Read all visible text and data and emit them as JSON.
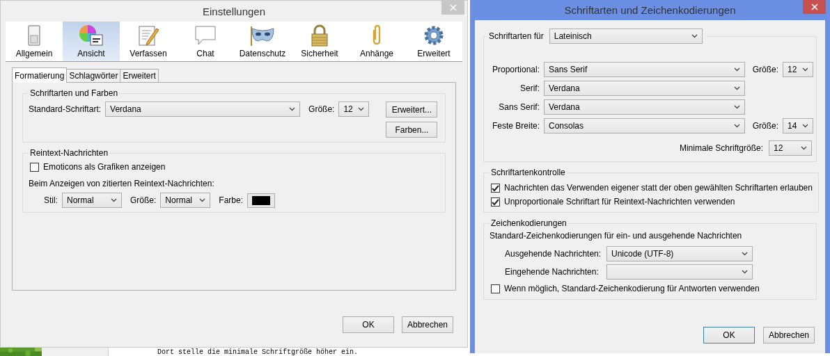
{
  "settings_window": {
    "title": "Einstellungen",
    "toolbar": [
      {
        "label": "Allgemein",
        "selected": false
      },
      {
        "label": "Ansicht",
        "selected": true
      },
      {
        "label": "Verfassen",
        "selected": false
      },
      {
        "label": "Chat",
        "selected": false
      },
      {
        "label": "Datenschutz",
        "selected": false
      },
      {
        "label": "Sicherheit",
        "selected": false
      },
      {
        "label": "Anhänge",
        "selected": false
      },
      {
        "label": "Erweitert",
        "selected": false
      }
    ],
    "tabs": [
      {
        "label": "Formatierung",
        "selected": true
      },
      {
        "label": "Schlagwörter",
        "selected": false
      },
      {
        "label": "Erweitert",
        "selected": false
      }
    ],
    "fonts_group": {
      "legend": "Schriftarten und Farben",
      "font_label": "Standard-Schriftart:",
      "font": "Verdana",
      "size_label": "Größe:",
      "size": "12",
      "buttons": [
        "Erweitert...",
        "Farben..."
      ]
    },
    "plaintext_group": {
      "legend": "Reintext-Nachrichten",
      "emoticons": {
        "label": "Emoticons als Grafiken anzeigen",
        "checked": false
      },
      "quoted_label": "Beim Anzeigen von zitierten Reintext-Nachrichten:",
      "style_label": "Stil:",
      "style": "Normal",
      "size_label": "Größe:",
      "size": "Normal",
      "color_label": "Farbe:",
      "color": "#000000"
    },
    "buttons": [
      "OK",
      "Abbrechen"
    ]
  },
  "background_text": "Dort stelle die minimale Schriftgröße höher ein.",
  "fonts_window": {
    "title": "Schriftarten und Zeichenkodierungen",
    "fonts_for_label": "Schriftarten für",
    "fonts_for": "Lateinisch",
    "rows": [
      {
        "label": "Proportional:",
        "value": "Sans Serif",
        "size_label": "Größe:",
        "size": "12"
      },
      {
        "label": "Serif:",
        "value": "Verdana"
      },
      {
        "label": "Sans Serif:",
        "value": "Verdana"
      },
      {
        "label": "Feste Breite:",
        "value": "Consolas",
        "size_label": "Größe:",
        "size": "14"
      }
    ],
    "min_size_label": "Minimale Schriftgröße:",
    "min_size": "12",
    "control_group": {
      "legend": "Schriftartenkontrolle",
      "options": [
        {
          "label": "Nachrichten das Verwenden eigener statt der oben gewählten Schriftarten erlauben",
          "checked": true
        },
        {
          "label": "Unproportionale Schriftart für Reintext-Nachrichten verwenden",
          "checked": true
        }
      ]
    },
    "encoding_group": {
      "legend": "Zeichenkodierungen",
      "description": "Standard-Zeichenkodierungen für ein- und ausgehende Nachrichten",
      "outgoing_label": "Ausgehende Nachrichten:",
      "outgoing": "Unicode (UTF-8)",
      "incoming_label": "Eingehende Nachrichten:",
      "use_default": {
        "label": "Wenn möglich, Standard-Zeichenkodierung für Antworten verwenden",
        "checked": false
      }
    },
    "buttons": [
      {
        "label": "OK",
        "focused": true
      },
      {
        "label": "Abbrechen",
        "focused": false
      }
    ]
  }
}
